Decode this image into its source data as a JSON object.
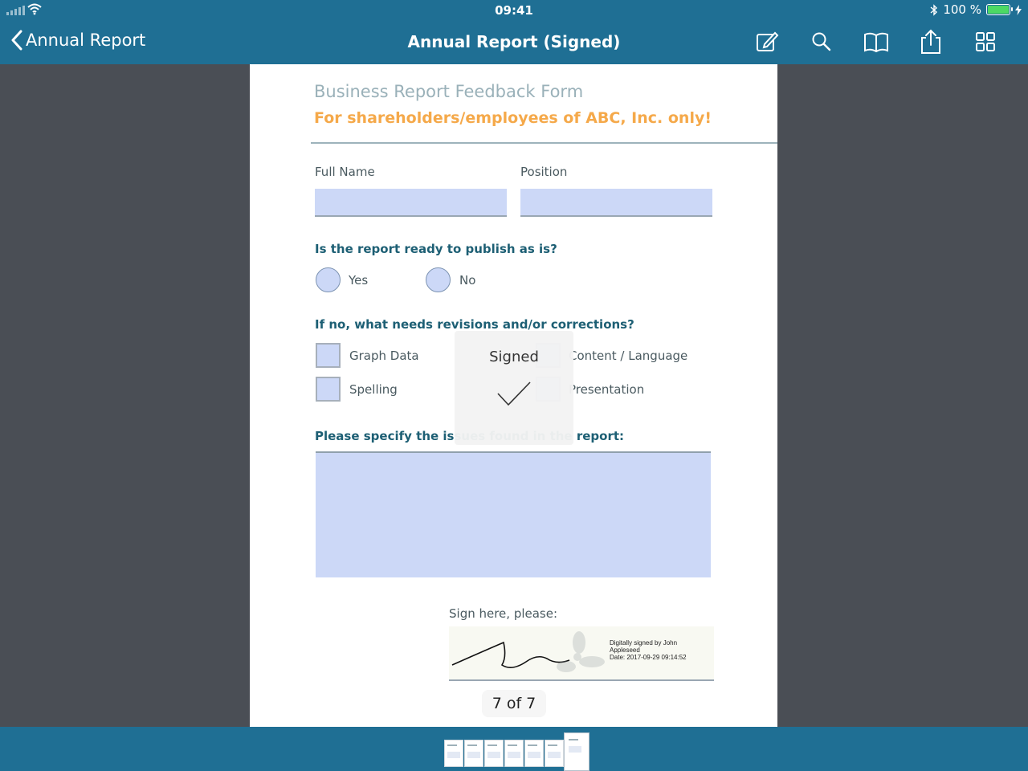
{
  "status_bar": {
    "time": "09:41",
    "battery_percent": "100 %"
  },
  "nav": {
    "back_label": "Annual Report",
    "title": "Annual Report (Signed)",
    "tools": [
      "edit-icon",
      "search-icon",
      "book-icon",
      "share-icon",
      "grid-icon"
    ]
  },
  "form": {
    "title": "Business Report Feedback Form",
    "subtitle": "For shareholders/employees of ABC, Inc. only!",
    "full_name_label": "Full Name",
    "position_label": "Position",
    "full_name_value": "",
    "position_value": "",
    "question_publish": "Is the report ready to publish as is?",
    "yes_label": "Yes",
    "no_label": "No",
    "question_revisions": "If no, what needs revisions and/or corrections?",
    "options": [
      "Graph Data",
      "Content / Language",
      "Spelling",
      "Presentation"
    ],
    "question_specify": "Please specify the issues found in the report:",
    "issues_value": "",
    "sign_label": "Sign here, please:",
    "signature_text": [
      "Digitally signed by John",
      "Appleseed",
      "Date: 2017-09-29 09:14:52"
    ]
  },
  "overlay": {
    "label": "Signed"
  },
  "page_indicator": "7 of 7",
  "thumbnails": {
    "count": 7,
    "active_index": 6
  },
  "colors": {
    "bar": "#1f6f94",
    "field_fill": "#ccd8f7",
    "title_gray": "#9ab1b9",
    "subtitle_orange": "#f5a94a",
    "question_teal": "#1d5f74"
  }
}
